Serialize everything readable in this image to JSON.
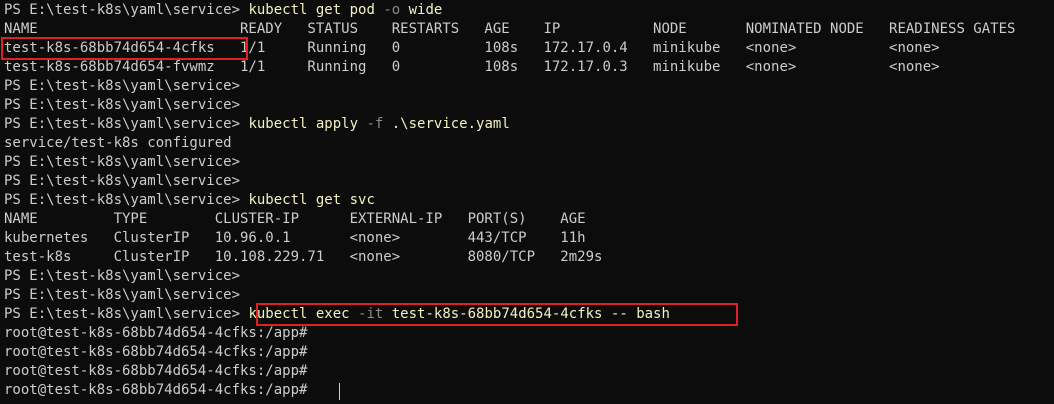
{
  "terminal": {
    "lines": [
      {
        "prompt": "PS E:\\test-k8s\\yaml\\service> ",
        "cmd": "kubectl",
        "args": " get pod ",
        "flag": "-o",
        "rest": " wide"
      },
      {
        "text": "NAME                        READY   STATUS    RESTARTS   AGE    IP           NODE       NOMINATED NODE   READINESS GATES"
      },
      {
        "text": "test-k8s-68bb74d654-4cfks   1/1     Running   0          108s   172.17.0.4   minikube   <none>           <none>"
      },
      {
        "text": "test-k8s-68bb74d654-fvwmz   1/1     Running   0          108s   172.17.0.3   minikube   <none>           <none>"
      },
      {
        "prompt": "PS E:\\test-k8s\\yaml\\service>"
      },
      {
        "prompt": "PS E:\\test-k8s\\yaml\\service>"
      },
      {
        "prompt": "PS E:\\test-k8s\\yaml\\service> ",
        "cmd": "kubectl",
        "args": " apply ",
        "flag": "-f",
        "rest": " .\\service.yaml"
      },
      {
        "text": "service/test-k8s configured"
      },
      {
        "prompt": "PS E:\\test-k8s\\yaml\\service>"
      },
      {
        "prompt": "PS E:\\test-k8s\\yaml\\service>"
      },
      {
        "prompt": "PS E:\\test-k8s\\yaml\\service> ",
        "cmd": "kubectl",
        "args": " get svc",
        "flag": "",
        "rest": ""
      },
      {
        "text": "NAME         TYPE        CLUSTER-IP      EXTERNAL-IP   PORT(S)    AGE"
      },
      {
        "text": "kubernetes   ClusterIP   10.96.0.1       <none>        443/TCP    11h"
      },
      {
        "text": "test-k8s     ClusterIP   10.108.229.71   <none>        8080/TCP   2m29s"
      },
      {
        "prompt": "PS E:\\test-k8s\\yaml\\service>"
      },
      {
        "prompt": "PS E:\\test-k8s\\yaml\\service>"
      },
      {
        "prompt": "PS E:\\test-k8s\\yaml\\service> ",
        "cmd": "kubectl",
        "args": " exec ",
        "flag": "-it",
        "rest": " test-k8s-68bb74d654-4cfks -- bash"
      },
      {
        "text": "root@test-k8s-68bb74d654-4cfks:/app#"
      },
      {
        "text": "root@test-k8s-68bb74d654-4cfks:/app#"
      },
      {
        "text": "root@test-k8s-68bb74d654-4cfks:/app#"
      },
      {
        "text": "root@test-k8s-68bb74d654-4cfks:/app# "
      }
    ]
  },
  "colors": {
    "background": "#0c0c0c",
    "text": "#cccccc",
    "command": "#f2f2c0",
    "flag": "#8a8a8a",
    "highlight": "#e02020"
  }
}
